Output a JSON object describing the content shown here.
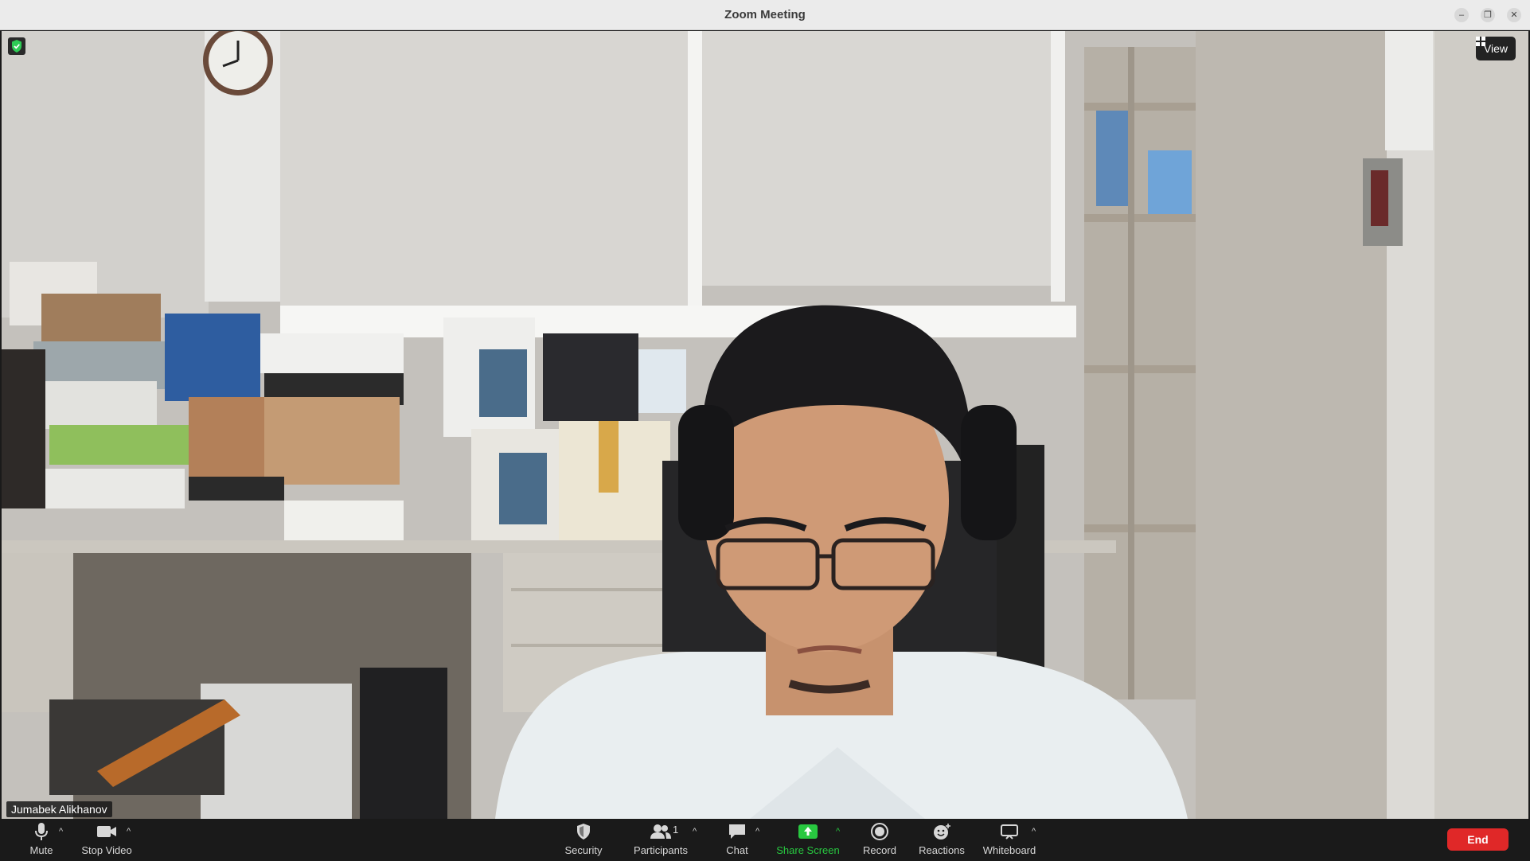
{
  "window": {
    "title": "Zoom Meeting"
  },
  "video": {
    "participant_name": "Jumabek Alikhanov",
    "view_label": "View"
  },
  "toolbar": {
    "mute_label": "Mute",
    "stop_video_label": "Stop Video",
    "security_label": "Security",
    "participants_label": "Participants",
    "participants_count": "1",
    "chat_label": "Chat",
    "share_screen_label": "Share Screen",
    "record_label": "Record",
    "reactions_label": "Reactions",
    "whiteboard_label": "Whiteboard",
    "end_label": "End"
  },
  "colors": {
    "end_button": "#e02828",
    "share_screen": "#28c840",
    "toolbar_bg": "#1a1a1a",
    "encryption_badge": "#2ecc55"
  },
  "icons": [
    "shield-icon",
    "view-grid-icon",
    "microphone-icon",
    "video-camera-icon",
    "security-shield-icon",
    "participants-icon",
    "chat-bubble-icon",
    "share-screen-icon",
    "record-icon",
    "reactions-icon",
    "whiteboard-icon"
  ]
}
